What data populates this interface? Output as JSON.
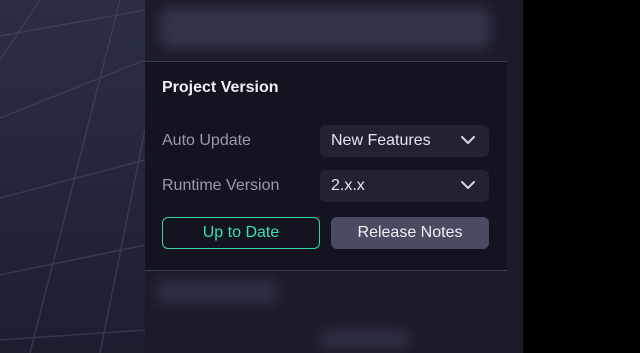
{
  "project_version": {
    "title": "Project Version",
    "auto_update": {
      "label": "Auto Update",
      "selected": "New Features"
    },
    "runtime_version": {
      "label": "Runtime Version",
      "selected": "2.x.x"
    },
    "up_to_date_label": "Up to Date",
    "release_notes_label": "Release Notes"
  },
  "colors": {
    "accent": "#35d6a4",
    "card_bg": "#141420",
    "secondary_button": "#4a4a63"
  }
}
